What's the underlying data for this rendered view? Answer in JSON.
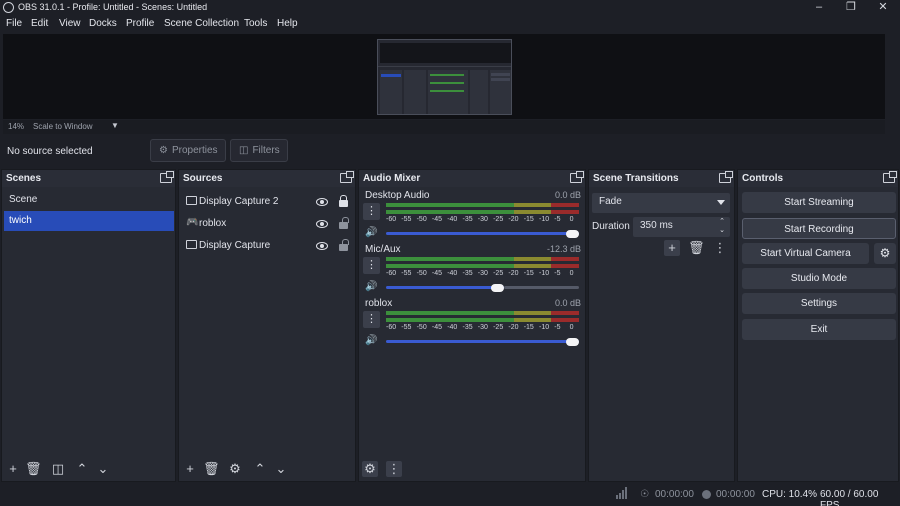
{
  "window": {
    "title": "OBS 31.0.1 - Profile: Untitled - Scenes: Untitled",
    "minimize_icon": "minimize-icon",
    "maximize_icon": "restore-icon",
    "close_icon": "close-icon"
  },
  "menu": [
    "File",
    "Edit",
    "View",
    "Docks",
    "Profile",
    "Scene Collection",
    "Tools",
    "Help"
  ],
  "preview": {
    "zoom": "14%",
    "scale_mode": "Scale to Window"
  },
  "context": {
    "no_source": "No source selected",
    "properties_label": "Properties",
    "filters_label": "Filters"
  },
  "scenes": {
    "title": "Scenes",
    "items": [
      "Scene",
      "twich"
    ],
    "selected": "twich"
  },
  "sources": {
    "title": "Sources",
    "items": [
      {
        "name": "Display Capture 2",
        "icon": "monitor-icon",
        "visible": true,
        "locked": true
      },
      {
        "name": "roblox",
        "icon": "gamepad-icon",
        "visible": true,
        "locked": false
      },
      {
        "name": "Display Capture",
        "icon": "monitor-icon",
        "visible": true,
        "locked": false
      }
    ]
  },
  "mixer": {
    "title": "Audio Mixer",
    "ticks": [
      "-60",
      "-55",
      "-50",
      "-45",
      "-40",
      "-35",
      "-30",
      "-25",
      "-20",
      "-15",
      "-10",
      "-5",
      "0"
    ],
    "channels": [
      {
        "name": "Desktop Audio",
        "db": "0.0 dB",
        "volume": 1.0
      },
      {
        "name": "Mic/Aux",
        "db": "-12.3 dB",
        "volume": 0.61
      },
      {
        "name": "roblox",
        "db": "0.0 dB",
        "volume": 1.0
      }
    ]
  },
  "transitions": {
    "title": "Scene Transitions",
    "selected": "Fade",
    "duration_label": "Duration",
    "duration_value": "350 ms"
  },
  "controls": {
    "title": "Controls",
    "start_streaming": "Start Streaming",
    "start_recording": "Start Recording",
    "start_virtual_camera": "Start Virtual Camera",
    "studio_mode": "Studio Mode",
    "settings": "Settings",
    "exit": "Exit"
  },
  "status": {
    "stream_time": "00:00:00",
    "record_time": "00:00:00",
    "cpu": "CPU: 10.4%",
    "fps": "60.00 / 60.00 FPS"
  },
  "colors": {
    "selection": "#284cb8",
    "background": "#1d1f26",
    "panel": "#272a33",
    "meter_green": "#3c8f3c",
    "meter_yellow": "#8a8a30",
    "meter_red": "#9a2b2b",
    "slider": "#3a5bd2"
  }
}
